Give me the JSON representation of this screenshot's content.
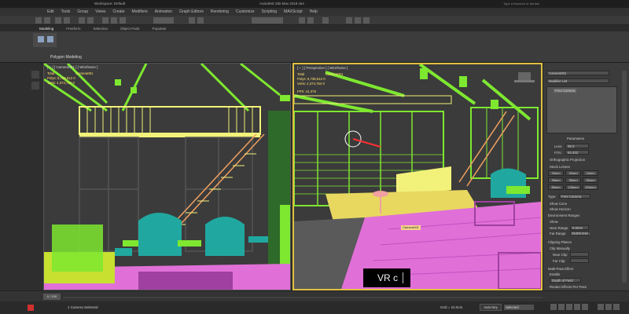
{
  "titlebar": {
    "workspace": "Workspace: Default",
    "title": "Autodesk 3ds Max 2018 x64",
    "search": "Type a keyword or phrase"
  },
  "menus": [
    "Edit",
    "Tools",
    "Group",
    "Views",
    "Create",
    "Modifiers",
    "Animation",
    "Graph Editors",
    "Rendering",
    "Customize",
    "Scripting",
    "MAXScript",
    "Help"
  ],
  "ribbon": {
    "tabs": [
      "Modeling",
      "Freeform",
      "Selection",
      "Object Paint",
      "Populate"
    ],
    "panel_label": "Polygon Modeling"
  },
  "viewport_left": {
    "label": "[ + ] [ Camera001 ] [ Wireframe ]",
    "stat_total": "Total",
    "stat_name": "Camera001",
    "polys": "Polys:  5,738,512  0",
    "verts": "Verts:  4,374,764  0"
  },
  "viewport_right": {
    "label": "[ + ] [ Perspective ] [ Wireframe ]",
    "stat_total": "Total",
    "stat_name": "Camera001",
    "polys": "Polys:  5,738,512  0",
    "verts": "Verts:  4,374,764  0",
    "fps": "FPS:   41.378",
    "camera_tag": "Camera001"
  },
  "command_panel": {
    "object_name": "Camera001",
    "modifier_list": "Modifier List",
    "stack_item": "Free Camera",
    "rollout": "Parameters",
    "lens_label": "Lens:",
    "lens_value": "35.0",
    "fov_label": "FOV:",
    "fov_value": "54.432",
    "ortho": "Orthographic Projection",
    "stock_lenses": "Stock Lenses",
    "lenses": [
      "15mm",
      "20mm",
      "24mm",
      "28mm",
      "35mm",
      "50mm",
      "85mm",
      "135mm",
      "200mm"
    ],
    "type_label": "Type:",
    "type_value": "Free Camera",
    "show_cone": "Show Cone",
    "show_horizon": "Show Horizon",
    "env_ranges": "Environment Ranges",
    "show": "Show",
    "near_label": "Near Range:",
    "near_value": "0.0mm",
    "far_label": "Far Range:",
    "far_value": "25400.0mm",
    "clipping": "Clipping Planes",
    "clip_manually": "Clip Manually",
    "near_clip": "Near Clip:",
    "far_clip": "Far Clip:",
    "multipass": "Multi-Pass Effect",
    "enable": "Enable",
    "effect_value": "Depth of Field",
    "render_effects": "Render Effects Per Pass"
  },
  "timeline": {
    "frame": "0 / 100"
  },
  "status": {
    "selection": "1 Camera Selected",
    "auto_key": "Auto Key",
    "selected": "Selected",
    "grid": "Grid = 10.0cm"
  },
  "overlay": {
    "vr_text": "VR c"
  },
  "colors": {
    "wire_green": "#7ee830",
    "wire_yellow": "#f2f27a",
    "wire_pink": "#e070d8",
    "wire_teal": "#20a8a0",
    "wire_orange": "#f0a060",
    "viewport_active": "#e0c040"
  }
}
